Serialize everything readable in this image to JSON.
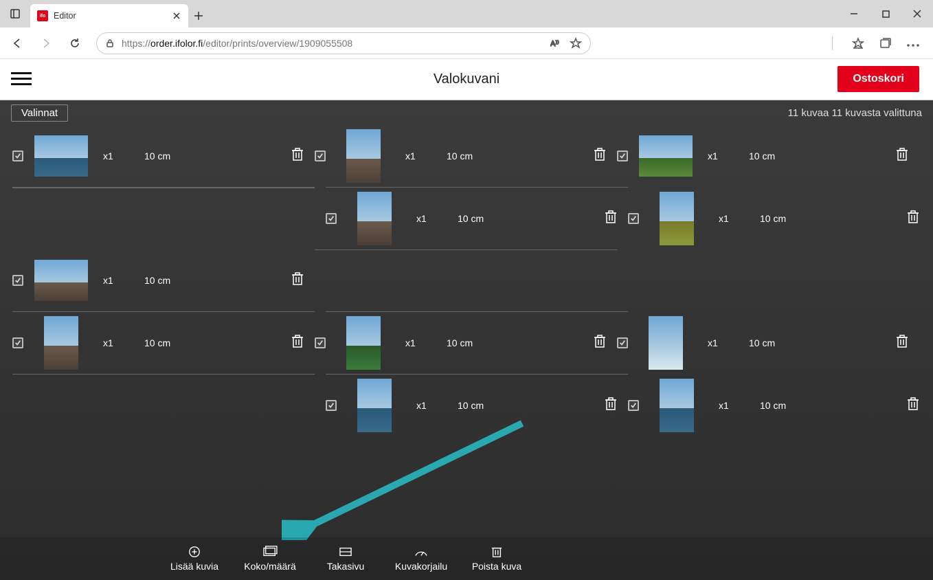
{
  "browser": {
    "tab_title": "Editor",
    "url_protocol": "https://",
    "url_domain": "order.ifolor.fi",
    "url_path": "/editor/prints/overview/1909055508"
  },
  "header": {
    "title": "Valokuvani",
    "cart_button": "Ostoskori"
  },
  "toolbar": {
    "options_button": "Valinnat",
    "selection_text": "11 kuvaa 11 kuvasta valittuna"
  },
  "items": [
    {
      "qty": "x1",
      "size": "10 cm",
      "orient": "landscape",
      "land": "sea"
    },
    {
      "qty": "x1",
      "size": "10 cm",
      "orient": "portrait",
      "land": "rock"
    },
    {
      "qty": "x1",
      "size": "10 cm",
      "orient": "landscape",
      "land": "green"
    },
    {
      "qty": "x1",
      "size": "10 cm",
      "orient": "portrait",
      "land": "rock"
    },
    {
      "qty": "x1",
      "size": "10 cm",
      "orient": "portrait",
      "land": "flowers"
    },
    {
      "qty": "x1",
      "size": "10 cm",
      "orient": "landscape",
      "land": "rock"
    },
    {
      "qty": "x1",
      "size": "10 cm",
      "orient": "portrait",
      "land": "rock"
    },
    {
      "qty": "x1",
      "size": "10 cm",
      "orient": "portrait",
      "land": "tree"
    },
    {
      "qty": "x1",
      "size": "10 cm",
      "orient": "portrait",
      "land": "sky2"
    },
    {
      "qty": "x1",
      "size": "10 cm",
      "orient": "portrait",
      "land": "sea"
    },
    {
      "qty": "x1",
      "size": "10 cm",
      "orient": "portrait",
      "land": "sea"
    }
  ],
  "bottom_buttons": {
    "add": "Lisää kuvia",
    "size_qty": "Koko/määrä",
    "backside": "Takasivu",
    "correction": "Kuvakorjailu",
    "delete": "Poista kuva"
  }
}
